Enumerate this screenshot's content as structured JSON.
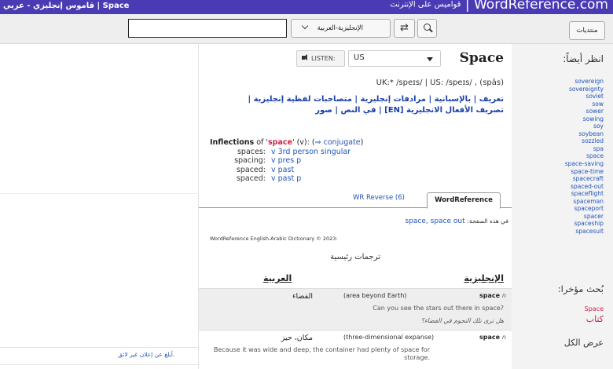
{
  "header": {
    "left_title": "قاموس إنجليزي - عربي | Space",
    "right_small": "قواميس على الإنترنت",
    "separator": "|",
    "brand": "WordReference.com"
  },
  "search": {
    "value": "",
    "language_pair": "الإنجليزية-العربية",
    "swap_icon": "⇄",
    "forums_label": "منتديات"
  },
  "entry": {
    "headword": "Space",
    "listen_label": "LISTEN:",
    "accent": "US",
    "pronunciation": "UK:* /speɪs/ | US: /speɪs/ , (spās)",
    "links": "تعريف | بالإسبانية | مرادفات إنجليزية | متصاحبات لفظية إنجليزية | تصريف الأفعال الانجليزية [EN] | في النص | صور"
  },
  "inflections": {
    "prefix": "Inflections",
    "of": "of '",
    "word": "space",
    "middle": "' (v): (",
    "conjugate": "⇒ conjugate",
    "suffix": ")",
    "rows": [
      {
        "form": "spaces:",
        "desc": "v 3rd person singular"
      },
      {
        "form": "spacing:",
        "desc": "v pres p"
      },
      {
        "form": "spaced:",
        "desc": "v past"
      },
      {
        "form": "spaced:",
        "desc": "v past p"
      }
    ]
  },
  "tabs": {
    "active": "WordReference",
    "reverse": "WR Reverse (6)"
  },
  "on_page": {
    "label": "في هذه الصفحة:",
    "items": "space, space out"
  },
  "copyright": "WordReference English-Arabic Dictionary © 2023:",
  "section_title": "ترجمات رئيسية",
  "columns": {
    "english": "الإنجليزية",
    "arabic": "العربية"
  },
  "entries": [
    {
      "hw": "space",
      "pos": "n",
      "sense": "(area beyond Earth)",
      "arabic": "الفضاء",
      "example_en": "Can you see the stars out there in space?",
      "example_ar": "هل ترى تلك النجوم في الفضاء؟"
    },
    {
      "hw": "space",
      "pos": "n",
      "sense": "(three-dimensional expanse)",
      "arabic": "مكان، حيز",
      "example_en": "Because it was wide and deep, the container had plenty of space for storage."
    }
  ],
  "sidebar": {
    "see_also_title": "انظر أيضاً:",
    "related": [
      "sovereign",
      "sovereignty",
      "soviet",
      "sow",
      "sower",
      "sowing",
      "soy",
      "soybean",
      "sozzled",
      "spa",
      "space",
      "space-saving",
      "space-time",
      "spacecraft",
      "spaced-out",
      "spaceflight",
      "spaceman",
      "spaceport",
      "spacer",
      "spaceship",
      "spacesuit"
    ],
    "recent_title": "بُحث مؤخرا:",
    "recent": [
      "Space",
      "كتاب"
    ],
    "show_all": "عرض الكل"
  },
  "ads": {
    "report": "أبلغ عن إعلان غير لائق."
  }
}
